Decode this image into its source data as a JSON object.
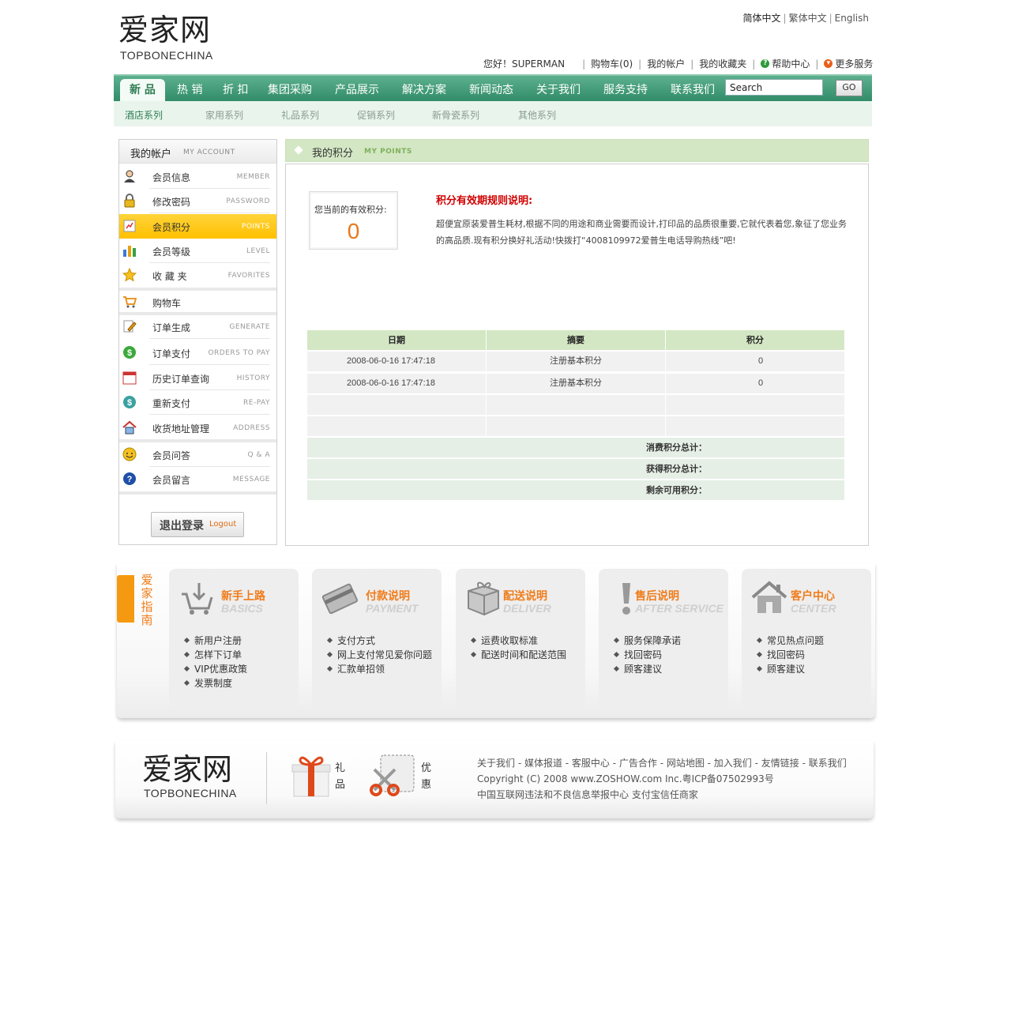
{
  "header": {
    "logo_cn": "爱家网",
    "logo_en": "TOPBONECHINA",
    "languages": [
      "简体中文",
      "繁体中文",
      "English"
    ],
    "greeting": "您好！SUPERMAN",
    "cart": "购物车(0)",
    "my_account": "我的帐户",
    "favorites": "我的收藏夹",
    "help": "帮助中心",
    "more": "更多服务"
  },
  "nav": {
    "items": [
      "新 品",
      "热 销",
      "折 扣",
      "集团采购",
      "产品展示",
      "解决方案",
      "新闻动态",
      "关于我们",
      "服务支持",
      "联系我们"
    ],
    "search_value": "Search",
    "go_label": "GO",
    "sub_items": [
      "酒店系列",
      "家用系列",
      "礼品系列",
      "促销系列",
      "新骨瓷系列",
      "其他系列"
    ]
  },
  "sidebar": {
    "title": "我的帐户",
    "title_en": "MY ACCOUNT",
    "items": [
      {
        "label": "会员信息",
        "en": "MEMBER",
        "icon": "user-icon"
      },
      {
        "label": "修改密码",
        "en": "PASSWORD",
        "icon": "lock-icon"
      },
      {
        "label": "会员积分",
        "en": "POINTS",
        "icon": "points-icon"
      },
      {
        "label": "会员等级",
        "en": "LEVEL",
        "icon": "bar-chart-icon"
      },
      {
        "label": "收 藏 夹",
        "en": "FAVORITES",
        "icon": "star-icon"
      },
      {
        "label": "购物车",
        "en": "",
        "icon": "cart-icon"
      },
      {
        "label": "订单生成",
        "en": "GENERATE",
        "icon": "edit-icon"
      },
      {
        "label": "订单支付",
        "en": "ORDERS TO PAY",
        "icon": "dollar-icon"
      },
      {
        "label": "历史订单查询",
        "en": "HISTORY",
        "icon": "calendar-icon"
      },
      {
        "label": "重新支付",
        "en": "RE-PAY",
        "icon": "repay-icon"
      },
      {
        "label": "收货地址管理",
        "en": "ADDRESS",
        "icon": "house-icon"
      },
      {
        "label": "会员问答",
        "en": "Q & A",
        "icon": "chat-icon"
      },
      {
        "label": "会员留言",
        "en": "MESSAGE",
        "icon": "question-icon"
      }
    ],
    "logout_cn": "退出登录",
    "logout_en": "Logout"
  },
  "main": {
    "title": "我的积分",
    "title_en": "MY POINTS",
    "current_points_label": "您当前的有效积分:",
    "current_points": "0",
    "rule_title": "积分有效期规则说明:",
    "rule_text": "超便宜原装爱普生耗材,根据不同的用途和商业需要而设计,打印品的品质很重要,它就代表着您,象征了您业务的高品质.现有积分换好礼活动!快拨打“4008109972爱普生电话导购热线”吧!",
    "table": {
      "headers": [
        "日期",
        "摘要",
        "积分"
      ],
      "rows": [
        [
          "2008-06-0-16 17:47:18",
          "注册基本积分",
          "0"
        ],
        [
          "2008-06-0-16 17:47:18",
          "注册基本积分",
          "0"
        ],
        [
          "",
          "",
          ""
        ],
        [
          "",
          "",
          ""
        ]
      ],
      "totals": [
        "消费积分总计：",
        "获得积分总计：",
        "剩余可用积分："
      ]
    }
  },
  "guide": {
    "title": "爱家指南",
    "cards": [
      {
        "cn": "新手上路",
        "en": "BASICS",
        "icon": "cart-download-icon",
        "items": [
          "新用户注册",
          "怎样下订单",
          "VIP优惠政策",
          "发票制度"
        ]
      },
      {
        "cn": "付款说明",
        "en": "PAYMENT",
        "icon": "credit-card-icon",
        "items": [
          "支付方式",
          "网上支付常见爱你问题",
          "汇款单招领"
        ]
      },
      {
        "cn": "配送说明",
        "en": "DELIVER",
        "icon": "gift-box-icon",
        "items": [
          "运费收取标准",
          "配送时间和配送范围"
        ]
      },
      {
        "cn": "售后说明",
        "en": "AFTER SERVICE",
        "icon": "exclamation-icon",
        "items": [
          "服务保障承诺",
          "找回密码",
          "顾客建议"
        ]
      },
      {
        "cn": "客户中心",
        "en": "CENTER",
        "icon": "house-icon",
        "items": [
          "常见热点问题",
          "找回密码",
          "顾客建议"
        ]
      }
    ]
  },
  "footer": {
    "logo_cn": "爱家网",
    "logo_en": "TOPBONECHINA",
    "gift_label": "礼品",
    "discount_label": "优惠",
    "links": "关于我们 - 媒体报道 - 客服中心 - 广告合作 - 网站地图 - 加入我们 - 友情链接 - 联系我们",
    "copyright": "Copyright (C) 2008 www.ZOSHOW.com Inc.粤ICP备07502993号",
    "trust": "中国互联网违法和不良信息举报中心 支付宝信任商家"
  },
  "colors": {
    "nav_green": "#3a9472",
    "accent_orange": "#f07c1a",
    "active_yellow": "#ffc000",
    "rule_red": "#d00000",
    "table_green": "#d3e7c4"
  }
}
